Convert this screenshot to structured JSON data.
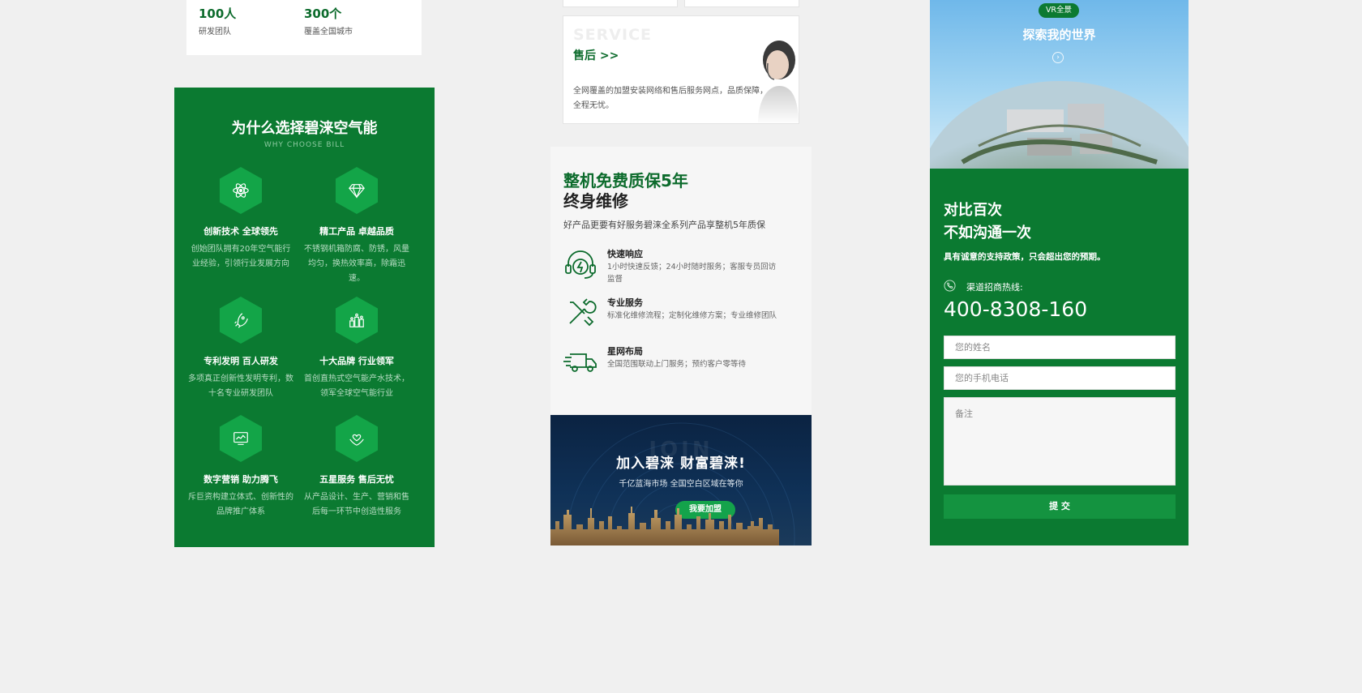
{
  "stats": [
    {
      "number": "100人",
      "label": "研发团队"
    },
    {
      "number": "300个",
      "label": "覆盖全国城市"
    }
  ],
  "why": {
    "title": "为什么选择碧涞空气能",
    "subtitle": "WHY CHOOSE BILL",
    "features": [
      {
        "icon": "atom-icon",
        "title": "创新技术 全球领先",
        "desc": "创始团队拥有20年空气能行业经验，引领行业发展方向"
      },
      {
        "icon": "diamond-icon",
        "title": "精工产品 卓越品质",
        "desc": "不锈钢机箱防腐、防锈，风量均匀，换热效率高，除霜迅速。"
      },
      {
        "icon": "rocket-icon",
        "title": "专利发明 百人研发",
        "desc": "多项真正创新性发明专利，数十名专业研发团队"
      },
      {
        "icon": "podium-icon",
        "title": "十大品牌 行业领军",
        "desc": "首创直热式空气能产水技术，领军全球空气能行业"
      },
      {
        "icon": "monitor-chart-icon",
        "title": "数字营销 助力腾飞",
        "desc": "斥巨资构建立体式、创新性的品牌推广体系"
      },
      {
        "icon": "heart-hands-icon",
        "title": "五星服务 售后无忧",
        "desc": "从产品设计、生产、营销和售后每一环节中创造性服务"
      }
    ]
  },
  "service": {
    "en": "SERVICE",
    "cn": "售后 >>",
    "desc": "全网覆盖的加盟安装网络和售后服务网点，品质保障，全程无忧。"
  },
  "warranty": {
    "title1": "整机免费质保5年",
    "title2": "终身维修",
    "subtitle": "好产品更要有好服务碧涞全系列产品享整机5年质保",
    "items": [
      {
        "icon": "headset-icon",
        "title": "快速响应",
        "desc": "1小时快速反馈；24小时随时服务；客服专员回访监督"
      },
      {
        "icon": "tools-icon",
        "title": "专业服务",
        "desc": "标准化维修流程；定制化维修方案；专业维修团队"
      },
      {
        "icon": "truck-icon",
        "title": "星网布局",
        "desc": "全国范围联动上门服务；预约客户零等待"
      }
    ]
  },
  "join": {
    "en": "JOIN",
    "title": "加入碧涞 财富碧涞!",
    "subtitle": "千亿蓝海市场 全国空白区域在等你",
    "button": "我要加盟"
  },
  "vr": {
    "badge": "VR全景",
    "title": "探索我的世界"
  },
  "contact": {
    "title1": "对比百次",
    "title2": "不如沟通一次",
    "subtitle": "具有诚意的支持政策，只会超出您的预期。",
    "hotline_label": "渠道招商热线:",
    "phone": "400-8308-160",
    "name_placeholder": "您的姓名",
    "phone_placeholder": "您的手机电话",
    "note_placeholder": "备注",
    "submit": "提 交"
  },
  "colors": {
    "brand_green": "#0b7a31",
    "hex_green": "#13a548",
    "join_navy": "#0b2342"
  }
}
